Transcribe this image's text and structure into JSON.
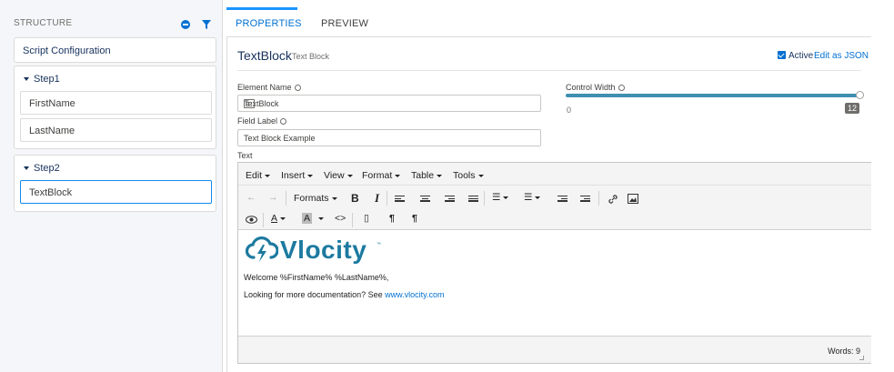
{
  "structure": {
    "title": "STRUCTURE",
    "script_config": "Script Configuration",
    "steps": [
      {
        "label": "Step1",
        "items": [
          "FirstName",
          "LastName"
        ]
      },
      {
        "label": "Step2",
        "items": [
          "TextBlock"
        ]
      }
    ]
  },
  "tabs": {
    "properties": "PROPERTIES",
    "preview": "PREVIEW"
  },
  "element": {
    "title": "TextBlock",
    "subtitle": "Text Block",
    "active_label": "Active",
    "active": true,
    "edit_json": "Edit as JSON"
  },
  "fields": {
    "element_name_label": "Element Name",
    "element_name_value": "TextBlock",
    "field_label_label": "Field Label",
    "field_label_value": "Text Block Example",
    "text_label": "Text",
    "control_width_label": "Control Width",
    "control_width_min": "0",
    "control_width_value": "12"
  },
  "editor": {
    "menus": [
      "Edit",
      "Insert",
      "View",
      "Format",
      "Table",
      "Tools"
    ],
    "formats_label": "Formats",
    "logo_text": "Vlocity",
    "logo_tm": "™",
    "welcome": "Welcome %FirstName% %LastName%,",
    "doc_prefix": "Looking for more documentation? See ",
    "doc_link": "www.vlocity.com",
    "words": "Words: 9"
  },
  "colors": {
    "accent": "#0070d2",
    "logo": "#1d7aa0",
    "slider": "#3e8fb0"
  }
}
